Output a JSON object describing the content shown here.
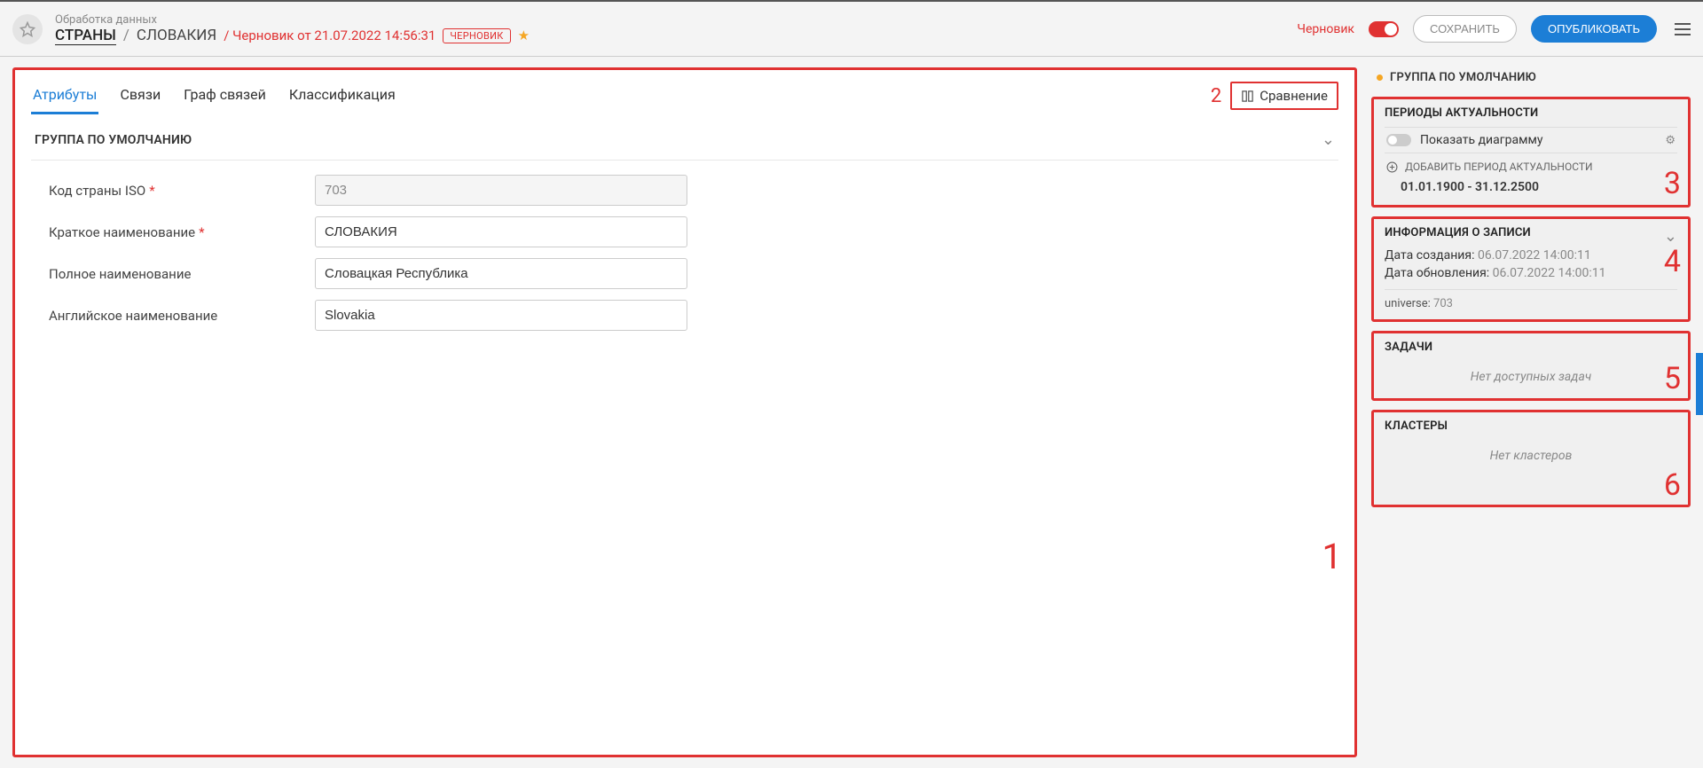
{
  "header": {
    "category": "Обработка данных",
    "root": "СТРАНЫ",
    "sep": "/",
    "name": "СЛОВАКИЯ",
    "draft_info": "/ Черновик от 21.07.2022 14:56:31",
    "badge": "ЧЕРНОВИК",
    "toggle_label": "Черновик",
    "save": "СОХРАНИТЬ",
    "publish": "ОПУБЛИКОВАТЬ"
  },
  "tabs": {
    "t0": "Атрибуты",
    "t1": "Связи",
    "t2": "Граф связей",
    "t3": "Классификация"
  },
  "compare": {
    "num": "2",
    "label": "Сравнение"
  },
  "group": {
    "title": "ГРУППА ПО УМОЛЧАНИЮ"
  },
  "fields": {
    "iso": {
      "label": "Код страны ISO",
      "value": "703"
    },
    "short": {
      "label": "Краткое наименование",
      "value": "СЛОВАКИЯ"
    },
    "full": {
      "label": "Полное наименование",
      "value": "Словацкая Республика"
    },
    "eng": {
      "label": "Английское наименование",
      "value": "Slovakia"
    }
  },
  "annot": {
    "a1": "1",
    "a3": "3",
    "a4": "4",
    "a5": "5",
    "a6": "6"
  },
  "side": {
    "top_title": "ГРУППА ПО УМОЛЧАНИЮ",
    "periods": {
      "title": "ПЕРИОДЫ АКТУАЛЬНОСТИ",
      "show_diagram": "Показать диаграмму",
      "add": "ДОБАВИТЬ ПЕРИОД АКТУАЛЬНОСТИ",
      "range": "01.01.1900 - 31.12.2500"
    },
    "info": {
      "title": "ИНФОРМАЦИЯ О ЗАПИСИ",
      "created_l": "Дата создания:",
      "created_v": "06.07.2022 14:00:11",
      "updated_l": "Дата обновления:",
      "updated_v": "06.07.2022 14:00:11",
      "uni_l": "universe:",
      "uni_v": "703"
    },
    "tasks": {
      "title": "ЗАДАЧИ",
      "empty": "Нет доступных задач"
    },
    "clusters": {
      "title": "КЛАСТЕРЫ",
      "empty": "Нет кластеров"
    }
  }
}
